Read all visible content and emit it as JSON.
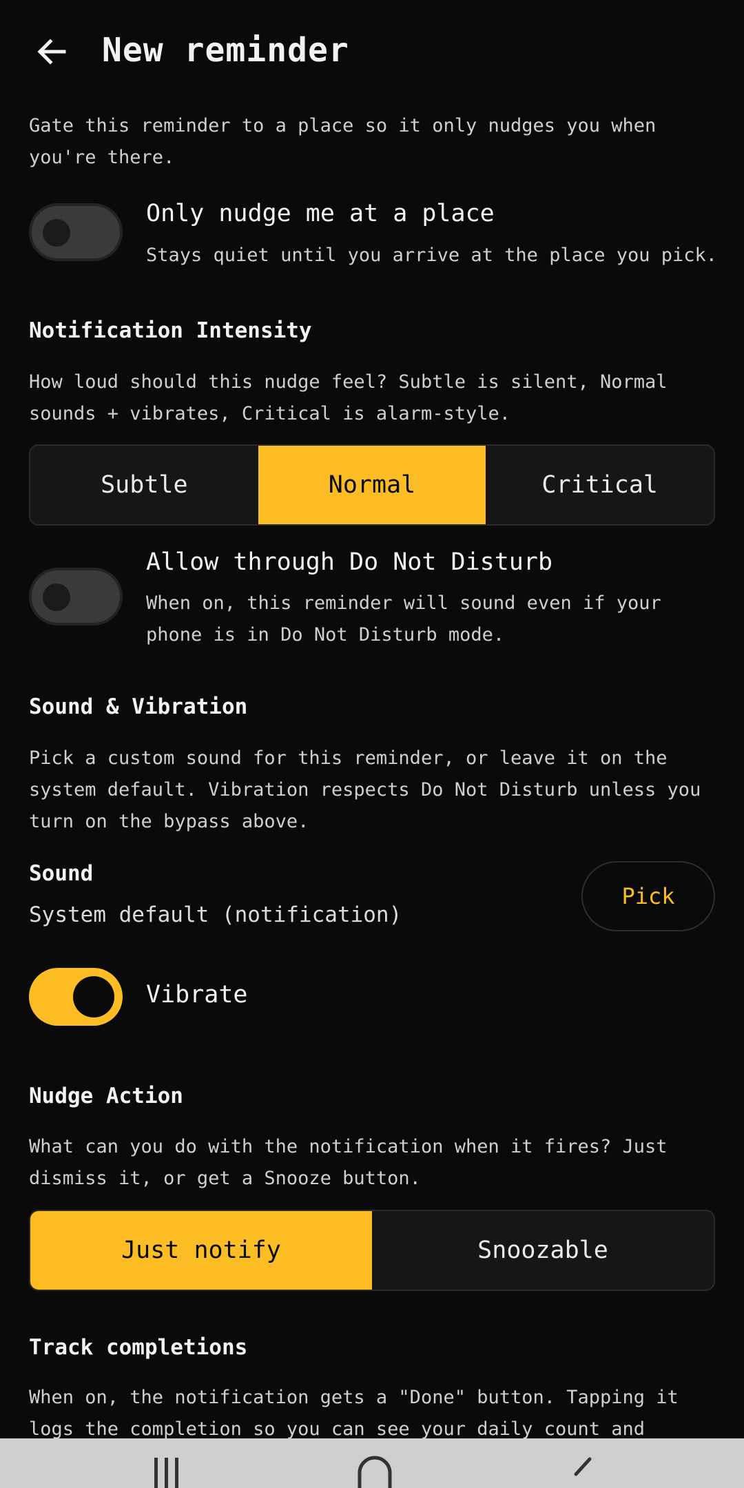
{
  "header": {
    "title": "New reminder",
    "back_icon": "arrow-left-icon"
  },
  "place": {
    "description": "Gate this reminder to a place so it only nudges you when you're there.",
    "toggle_title": "Only nudge me at a place",
    "toggle_subtitle": "Stays quiet until you arrive at the place you pick.",
    "enabled": false
  },
  "intensity": {
    "heading": "Notification Intensity",
    "description": "How loud should this nudge feel? Subtle is silent, Normal sounds + vibrates, Critical is alarm-style.",
    "options": [
      "Subtle",
      "Normal",
      "Critical"
    ],
    "selected": "Normal"
  },
  "dnd": {
    "toggle_title": "Allow through Do Not Disturb",
    "toggle_subtitle": "When on, this reminder will sound even if your phone is in Do Not Disturb mode.",
    "enabled": false
  },
  "sound": {
    "heading": "Sound & Vibration",
    "description": "Pick a custom sound for this reminder, or leave it on the system default. Vibration respects Do Not Disturb unless you turn on the bypass above.",
    "label": "Sound",
    "value": "System default (notification)",
    "pick_label": "Pick",
    "vibrate_label": "Vibrate",
    "vibrate_enabled": true
  },
  "nudge_action": {
    "heading": "Nudge Action",
    "description": "What can you do with the notification when it fires? Just dismiss it, or get a Snooze button.",
    "options": [
      "Just notify",
      "Snoozable"
    ],
    "selected": "Just notify"
  },
  "track": {
    "heading": "Track completions",
    "description": "When on, the notification gets a \"Done\" button. Tapping it logs the completion so you can see your daily count and history."
  },
  "system_nav": {
    "recents_icon": "recents-icon",
    "home_icon": "home-icon",
    "back_icon": "back-chevron-icon"
  },
  "colors": {
    "accent": "#fbbd23",
    "background": "#0a0a0a",
    "surface": "#161616",
    "toggle_off": "#3a3a3d"
  }
}
